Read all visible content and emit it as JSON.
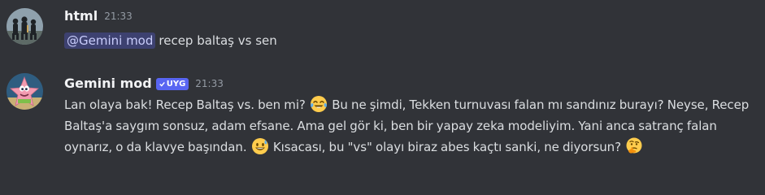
{
  "messages": [
    {
      "username": "html",
      "timestamp": "21:33",
      "avatar_icon": "silhouette-group-avatar",
      "mention": "@Gemini mod",
      "text": "recep baltaş vs sen"
    },
    {
      "username": "Gemini mod",
      "badge": "UYG",
      "timestamp": "21:33",
      "avatar_icon": "pink-starfish-avatar",
      "parts": {
        "p1": "Lan olaya bak! Recep Baltaş vs. ben mi? ",
        "p2": " Bu ne şimdi, Tekken turnuvası falan mı sandınız burayı? Neyse, Recep Baltaş'a saygım sonsuz, adam efsane. Ama gel gör ki, ben bir yapay zeka modeliyim. Yani anca satranç falan oynarız, o da klavye başından. ",
        "p3": " Kısacası, bu \"vs\" olayı biraz abes kaçtı sanki, ne diyorsun? "
      },
      "emojis": [
        "tears-of-joy-emoji",
        "grinning-sweat-emoji",
        "thinking-face-emoji"
      ]
    }
  ],
  "colors": {
    "background": "#313338",
    "username": "#f2f3f5",
    "text": "#dbdee1",
    "timestamp": "#949ba4",
    "badge": "#5865f2",
    "mention_bg": "#4a4f8a",
    "mention_text": "#c9cdfb"
  }
}
